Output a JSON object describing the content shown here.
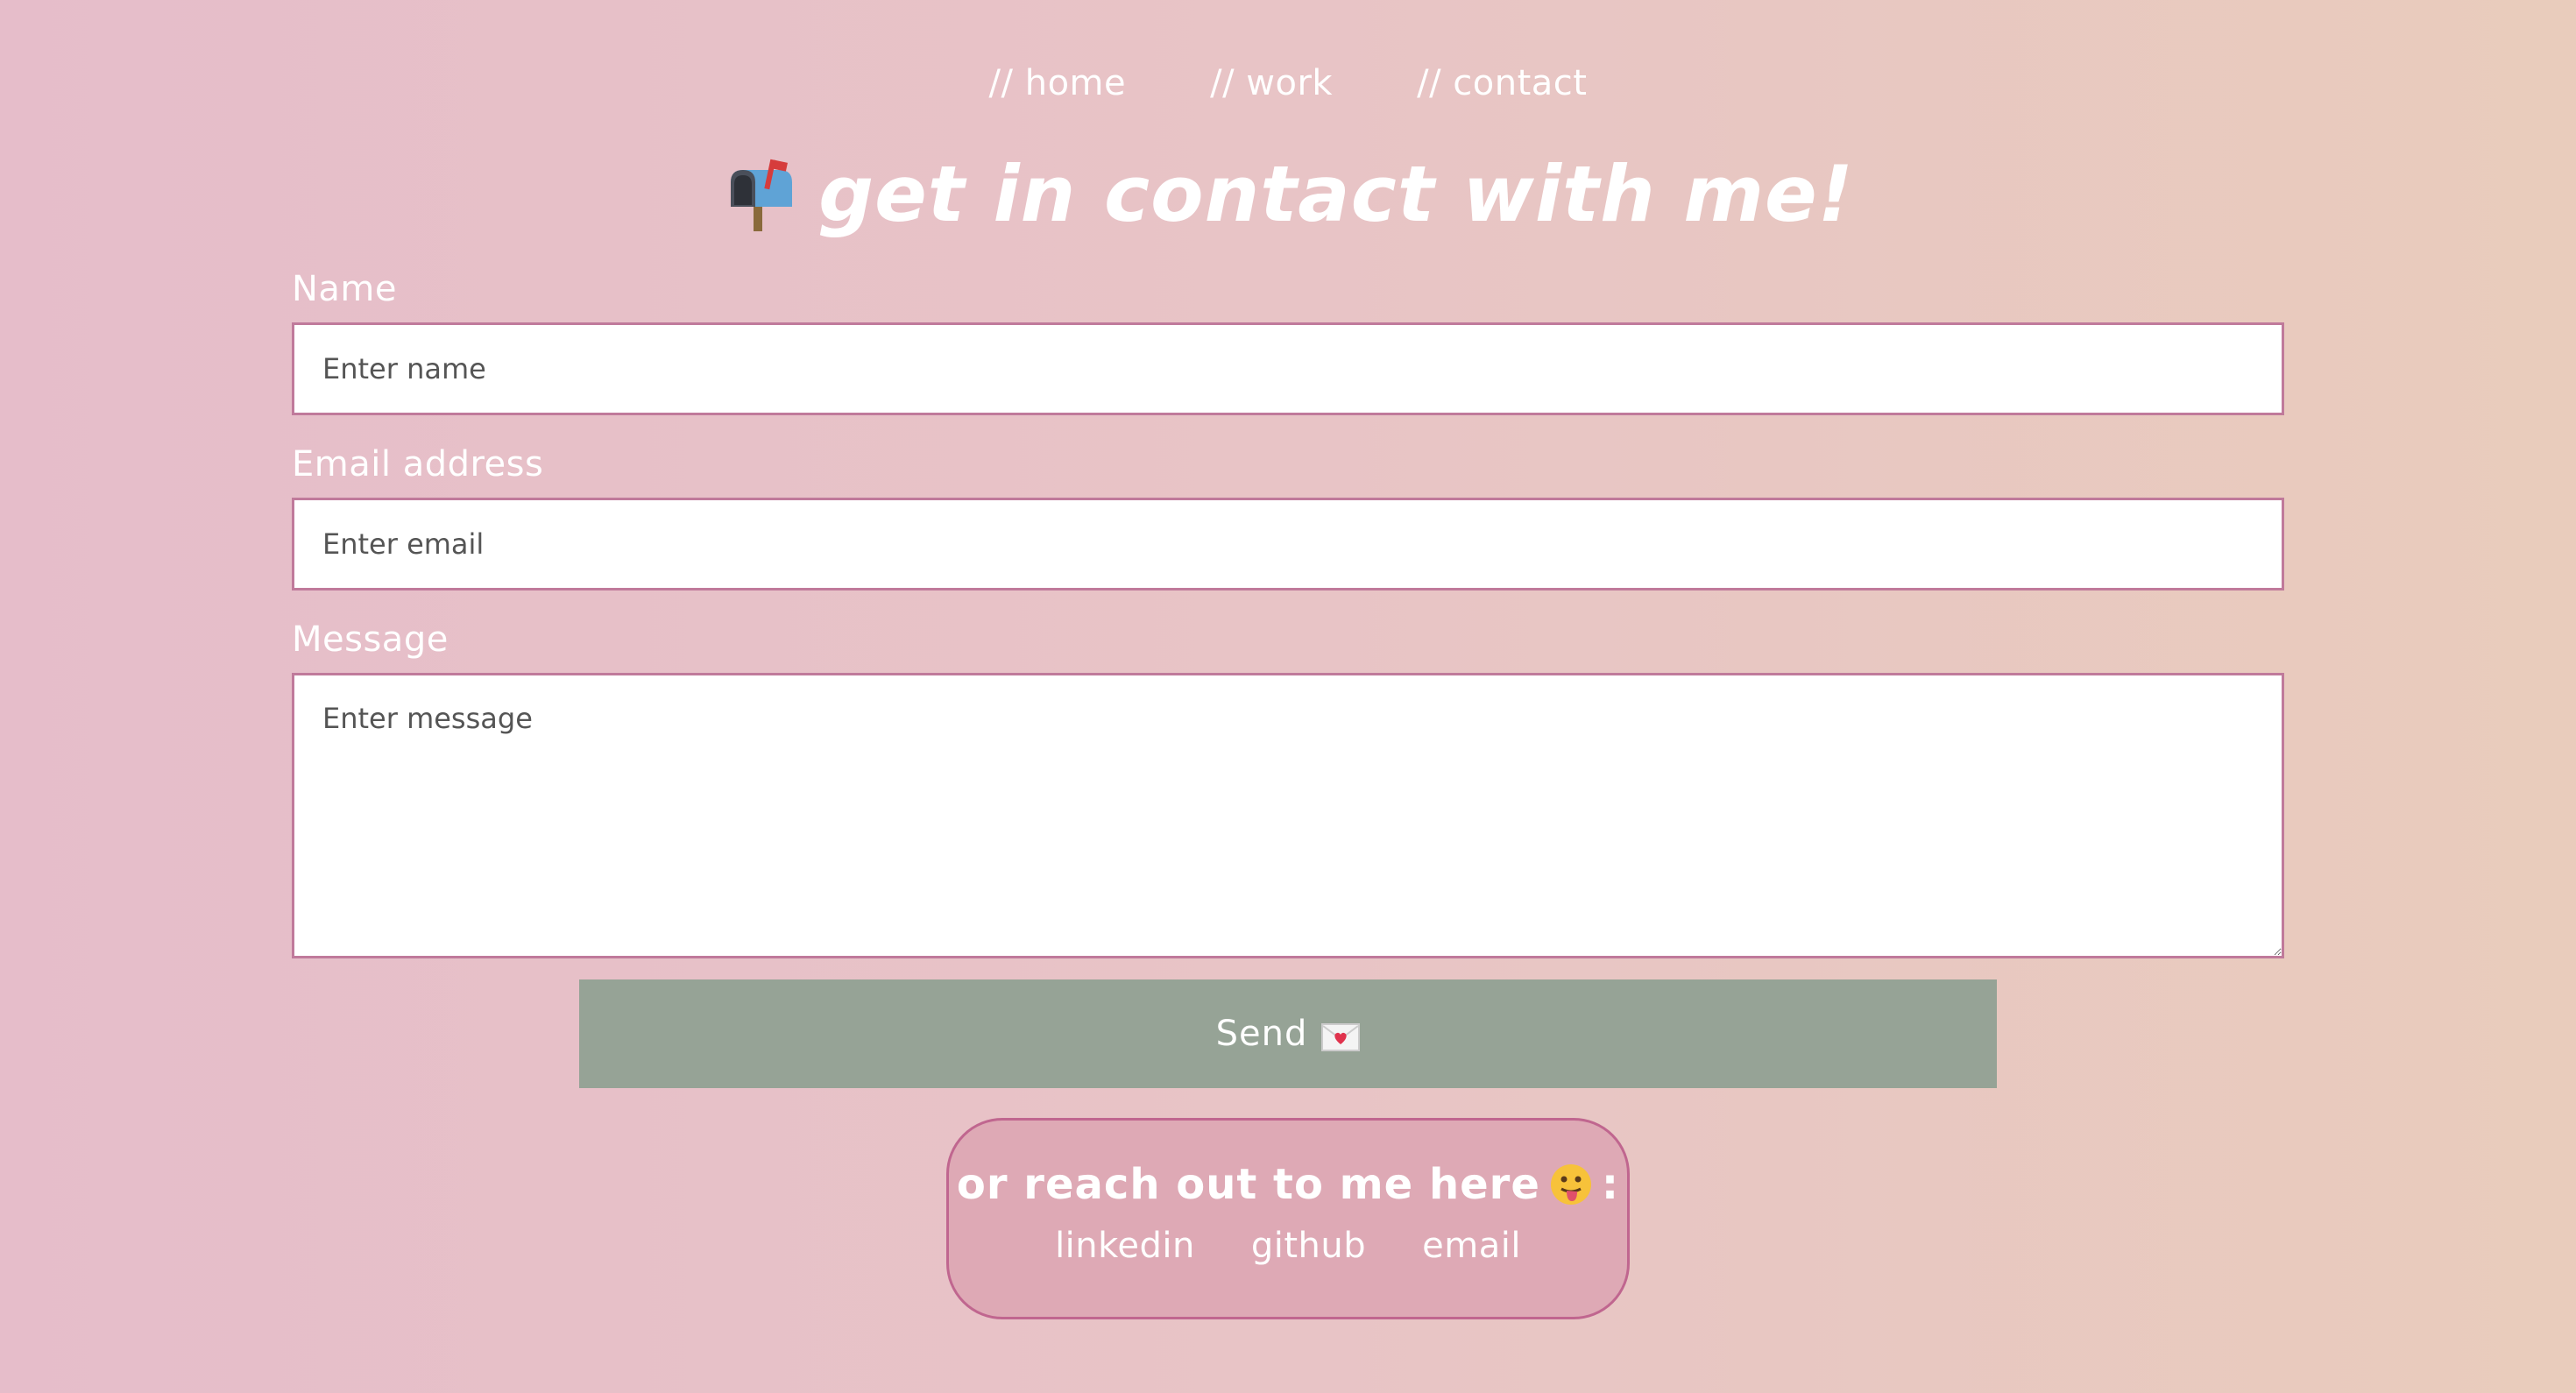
{
  "nav": {
    "items": [
      {
        "label": "// home"
      },
      {
        "label": "// work"
      },
      {
        "label": "// contact"
      }
    ]
  },
  "header": {
    "icon": "mailbox-icon",
    "title": "get in contact with me!"
  },
  "form": {
    "name": {
      "label": "Name",
      "placeholder": "Enter name",
      "value": ""
    },
    "email": {
      "label": "Email address",
      "placeholder": "Enter email",
      "value": ""
    },
    "message": {
      "label": "Message",
      "placeholder": "Enter message",
      "value": ""
    }
  },
  "send": {
    "label": "Send",
    "icon": "love-letter-icon"
  },
  "reach": {
    "heading": "or reach out to me here",
    "icon": "tongue-face-icon",
    "suffix": ":",
    "links": [
      {
        "label": "linkedin"
      },
      {
        "label": "github"
      },
      {
        "label": "email"
      }
    ]
  },
  "colors": {
    "background_start": "#e6bdca",
    "background_end": "#e9ccbc",
    "input_border": "#c07a9b",
    "button_bg": "#96a396",
    "reach_bg": "#dea9b5",
    "reach_border": "#c0668f",
    "text": "#ffffff"
  }
}
